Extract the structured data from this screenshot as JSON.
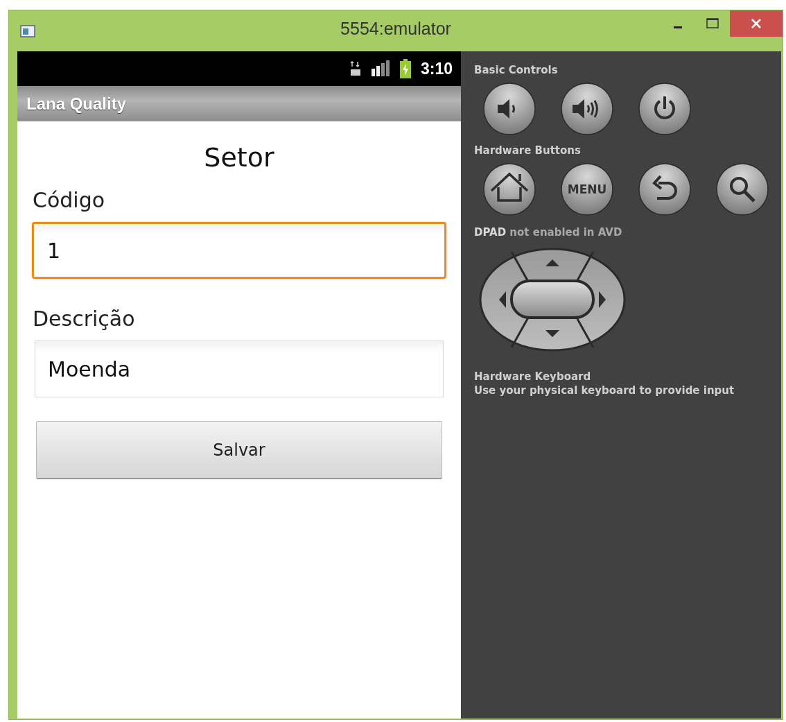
{
  "window": {
    "title": "5554:emulator"
  },
  "status_bar": {
    "time": "3:10"
  },
  "action_bar": {
    "title": "Lana Quality"
  },
  "form": {
    "heading": "Setor",
    "fields": [
      {
        "label": "Código",
        "value": "1",
        "focused": true
      },
      {
        "label": "Descrição",
        "value": "Moenda",
        "focused": false
      }
    ],
    "button": "Salvar"
  },
  "controls": {
    "basic_title": "Basic Controls",
    "hardware_title": "Hardware Buttons",
    "menu_label": "MENU",
    "dpad_note": "**DPAD** not enabled in AVD",
    "keyboard_title": "Hardware Keyboard",
    "keyboard_note": "Use your physical keyboard to provide input"
  }
}
